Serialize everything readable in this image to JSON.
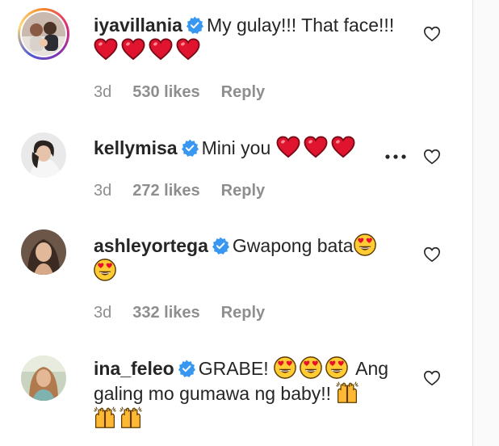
{
  "comments": [
    {
      "username": "iyavillania",
      "text_parts": [
        "My gulay!!! That face!!!"
      ],
      "time": "3d",
      "likes": "530 likes",
      "reply": "Reply"
    },
    {
      "username": "kellymisa",
      "text_parts": [
        "Mini you"
      ],
      "time": "3d",
      "likes": "272 likes",
      "reply": "Reply"
    },
    {
      "username": "ashleyortega",
      "text_parts": [
        "Gwapong bata"
      ],
      "time": "3d",
      "likes": "332 likes",
      "reply": "Reply"
    },
    {
      "username": "ina_feleo",
      "text_parts": [
        "GRABE!",
        "Ang galing mo gumawa ng baby!!"
      ],
      "time": "",
      "likes": "",
      "reply": ""
    }
  ],
  "icons": {
    "verified": "verified-badge-icon",
    "like": "heart-outline-icon",
    "more": "more-options-icon",
    "emoji_heart": "red-heart-emoji",
    "emoji_heart_eyes": "heart-eyes-emoji",
    "emoji_raised_hands": "raised-hands-emoji"
  },
  "colors": {
    "verified": "#3897f0",
    "heart": "#e0245e",
    "meta_text": "#8e8e8e",
    "username": "#262626"
  }
}
